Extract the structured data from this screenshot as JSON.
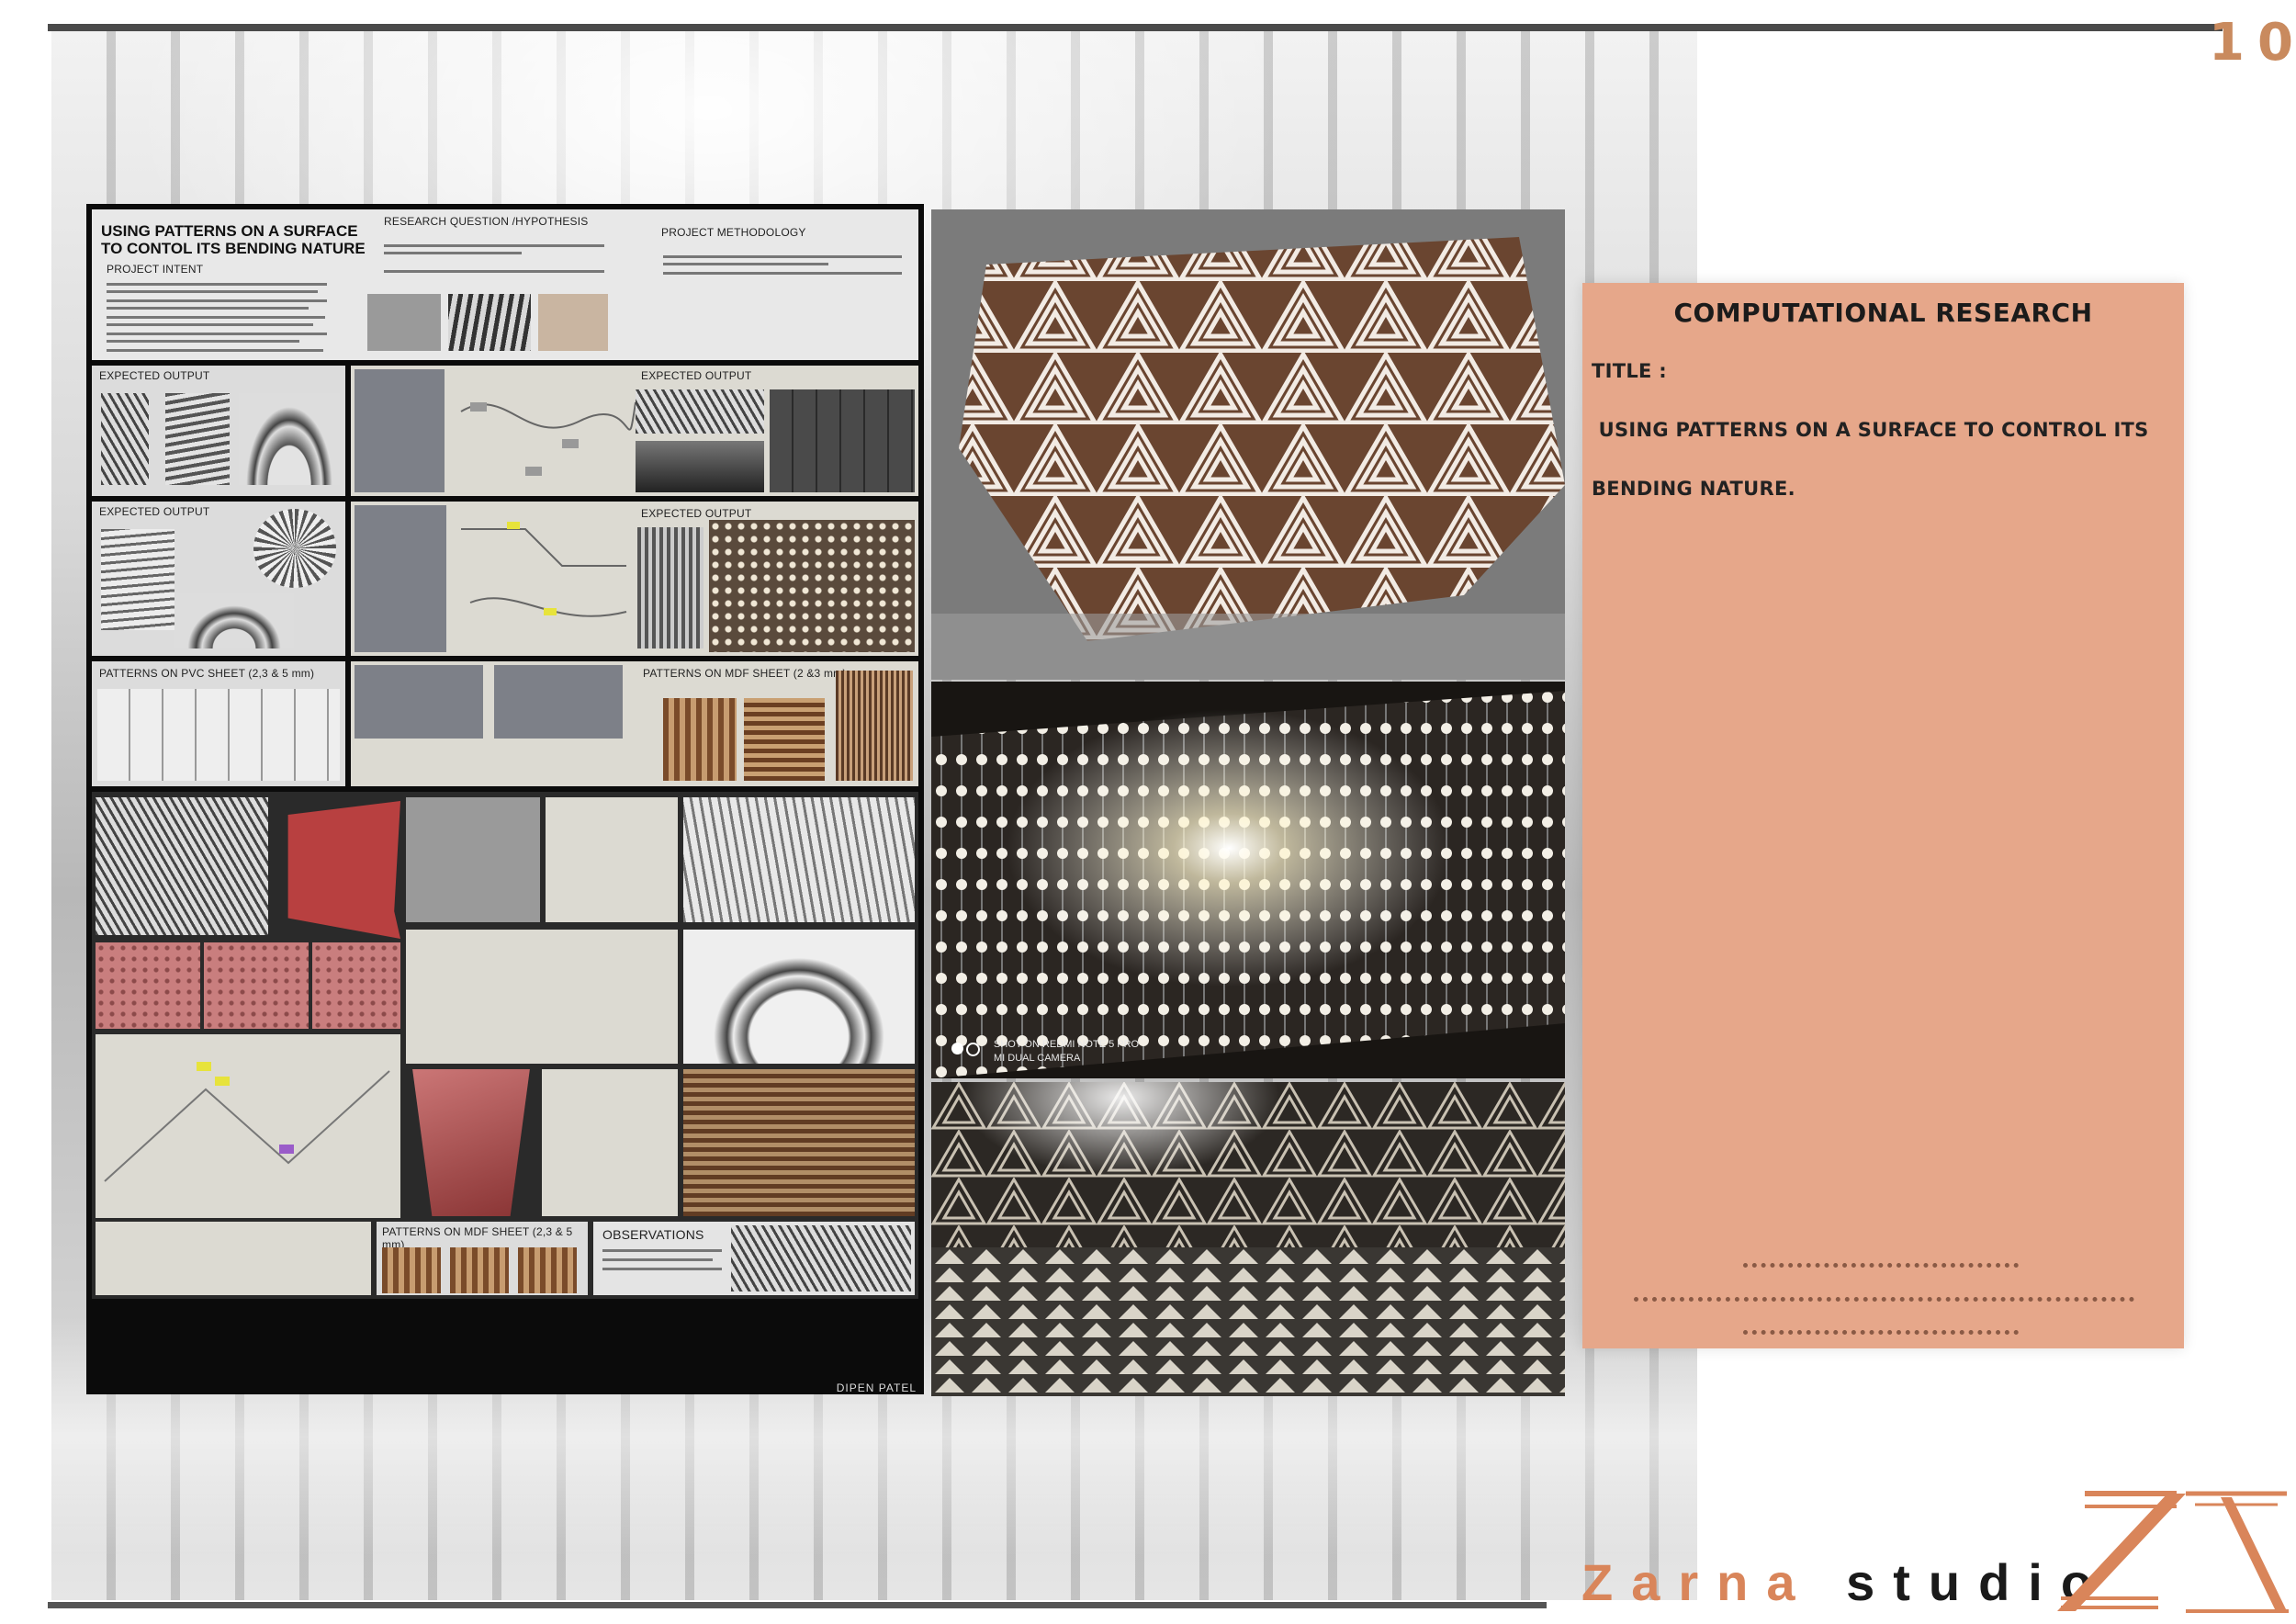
{
  "page_number": "10",
  "poster": {
    "title": "USING PATTERNS ON A SURFACE TO CONTOL ITS BENDING NATURE",
    "project_intent": "PROJECT INTENT",
    "research_question": "RESEARCH QUESTION /HYPOTHESIS",
    "methodology": "PROJECT METHODOLOGY",
    "expected_output": "EXPECTED OUTPUT",
    "pvc_sheet": "PATTERNS ON PVC SHEET (2,3 & 5 mm)",
    "mdf_sheet_a": "PATTERNS ON MDF SHEET (2 &3 mm)",
    "mdf_sheet_b": "PATTERNS ON MDF SHEET (2,3 & 5 mm)",
    "observations": "OBSERVATIONS",
    "author": "DIPEN PATEL"
  },
  "photo_caption": {
    "line1": "SHOT ON REDMI NOTE 5 PRO",
    "line2": "MI DUAL CAMERA"
  },
  "info_box": {
    "heading": "COMPUTATIONAL RESEARCH",
    "title_label": "TITLE :",
    "title_line1": " USING PATTERNS ON A SURFACE TO CONTROL ITS",
    "title_line2": "BENDING NATURE."
  },
  "logo": {
    "name_accent": "Zarna",
    "name_rest": "studio"
  },
  "colors": {
    "accent": "#d9855a",
    "box": "#e6a78a",
    "rule": "#4a4a4a"
  }
}
